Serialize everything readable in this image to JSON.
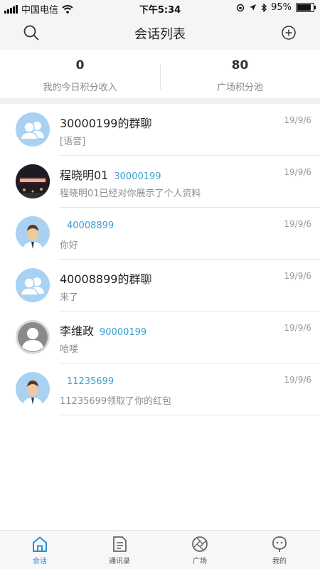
{
  "status_bar": {
    "carrier": "中国电信",
    "time": "下午5:34",
    "battery": "95%",
    "battery_level": 0.95
  },
  "header": {
    "title": "会话列表",
    "left_icon": "search-icon",
    "right_icon": "add-circle-icon"
  },
  "stats": [
    {
      "value": "0",
      "label": "我的今日积分收入"
    },
    {
      "value": "80",
      "label": "广场积分池"
    }
  ],
  "conversations": [
    {
      "avatar": "group-avatar",
      "name": "30000199的群聊",
      "uid": "",
      "preview": "[语音]",
      "date": "19/9/6"
    },
    {
      "avatar": "photo-avatar",
      "name": "程晓明01",
      "uid": "30000199",
      "preview": "程晓明01已经对你展示了个人资料",
      "date": "19/9/6"
    },
    {
      "avatar": "person-avatar",
      "name": "",
      "uid": "40008899",
      "preview": "你好",
      "date": "19/9/6"
    },
    {
      "avatar": "group-avatar",
      "name": "40008899的群聊",
      "uid": "",
      "preview": "来了",
      "date": "19/9/6"
    },
    {
      "avatar": "default-avatar",
      "name": "李维政",
      "uid": "90000199",
      "preview": "哈喽",
      "date": "19/9/6"
    },
    {
      "avatar": "person-avatar",
      "name": "",
      "uid": "11235699",
      "preview": "11235699领取了你的红包",
      "date": "19/9/6"
    }
  ],
  "tabs": [
    {
      "label": "会话",
      "icon": "home-icon",
      "active": true
    },
    {
      "label": "通讯录",
      "icon": "contacts-doc-icon",
      "active": false
    },
    {
      "label": "广场",
      "icon": "aperture-icon",
      "active": false
    },
    {
      "label": "我的",
      "icon": "profile-icon",
      "active": false
    }
  ],
  "colors": {
    "accent": "#2a8fd0",
    "uid": "#3a9fd0",
    "avatar_bg": "#a9d1f2"
  }
}
